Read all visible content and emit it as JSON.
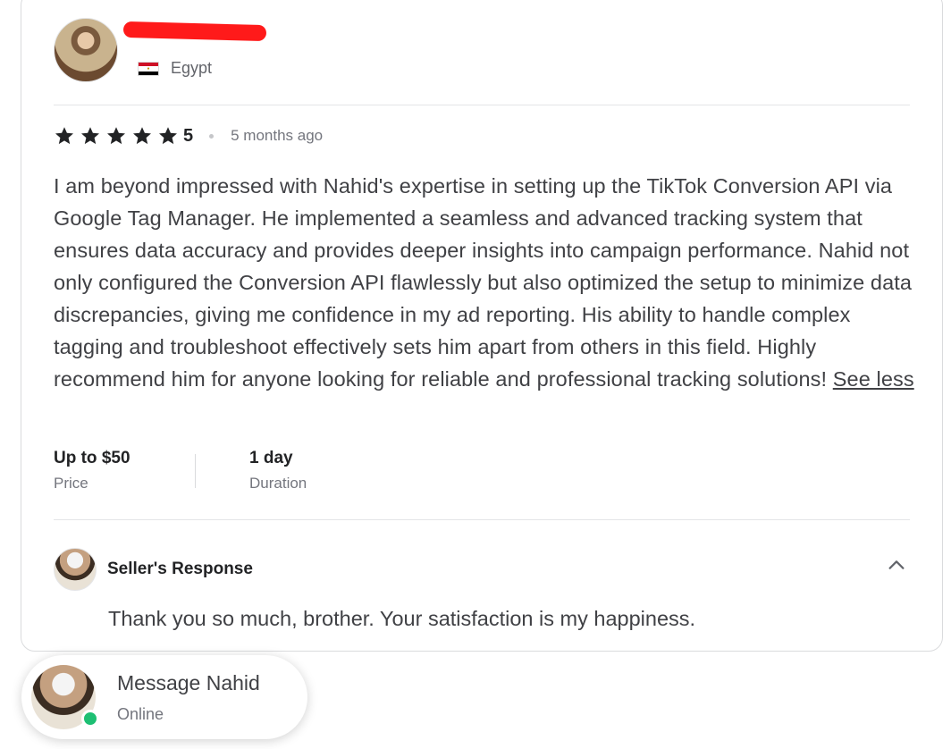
{
  "reviewer": {
    "name": "",
    "country": "Egypt"
  },
  "review": {
    "rating": "5",
    "stars": 5,
    "time_ago": "5 months ago",
    "text": "I am beyond impressed with Nahid's expertise in setting up the TikTok Conversion API via Google Tag Manager. He implemented a seamless and advanced tracking system that ensures data accuracy and provides deeper insights into campaign performance. Nahid not only configured the Conversion API flawlessly but also optimized the setup to minimize data discrepancies, giving me confidence in my ad reporting. His ability to handle complex tagging and troubleshoot effectively sets him apart from others in this field. Highly recommend him for anyone looking for reliable and professional tracking solutions!",
    "see_less_label": "See less"
  },
  "meta": {
    "price_value": "Up to $50",
    "price_label": "Price",
    "duration_value": "1 day",
    "duration_label": "Duration"
  },
  "seller_response": {
    "title": "Seller's Response",
    "text": "Thank you so much, brother. Your satisfaction is my happiness."
  },
  "message_widget": {
    "title": "Message Nahid",
    "status": "Online"
  },
  "colors": {
    "star": "#222325",
    "online": "#1dbf73",
    "redaction": "#ff1a1a"
  }
}
